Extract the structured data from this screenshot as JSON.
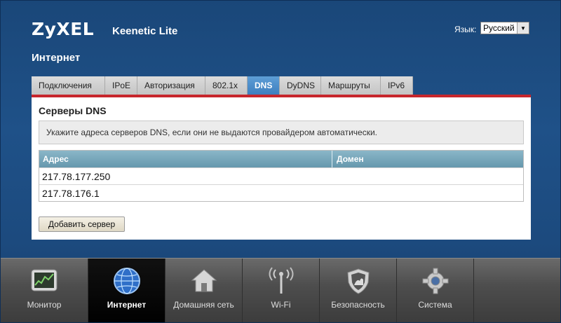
{
  "header": {
    "logo": "ZyXEL",
    "model": "Keenetic Lite",
    "language_label": "Язык:",
    "language_value": "Русский"
  },
  "page_title": "Интернет",
  "tabs": [
    {
      "label": "Подключения",
      "active": false
    },
    {
      "label": "IPoE",
      "active": false
    },
    {
      "label": "Авторизация",
      "active": false
    },
    {
      "label": "802.1x",
      "active": false
    },
    {
      "label": "DNS",
      "active": true
    },
    {
      "label": "DyDNS",
      "active": false
    },
    {
      "label": "Маршруты",
      "active": false
    },
    {
      "label": "IPv6",
      "active": false
    }
  ],
  "panel": {
    "title": "Серверы DNS",
    "info": "Укажите адреса серверов DNS, если они не выдаются провайдером автоматически.",
    "table": {
      "headers": [
        "Адрес",
        "Домен"
      ],
      "rows": [
        [
          "217.78.177.250",
          ""
        ],
        [
          "217.78.176.1",
          ""
        ]
      ]
    },
    "add_button": "Добавить сервер"
  },
  "dock": [
    {
      "label": "Монитор",
      "icon": "monitor-icon",
      "active": false
    },
    {
      "label": "Интернет",
      "icon": "globe-icon",
      "active": true
    },
    {
      "label": "Домашняя сеть",
      "icon": "home-icon",
      "active": false
    },
    {
      "label": "Wi-Fi",
      "icon": "wifi-antenna-icon",
      "active": false
    },
    {
      "label": "Безопасность",
      "icon": "shield-icon",
      "active": false
    },
    {
      "label": "Система",
      "icon": "gear-icon",
      "active": false
    }
  ],
  "colors": {
    "background": "#1f5188",
    "accent_red": "#c7262c",
    "active_tab": "#3e7fbf",
    "table_header": "#6698ad"
  }
}
